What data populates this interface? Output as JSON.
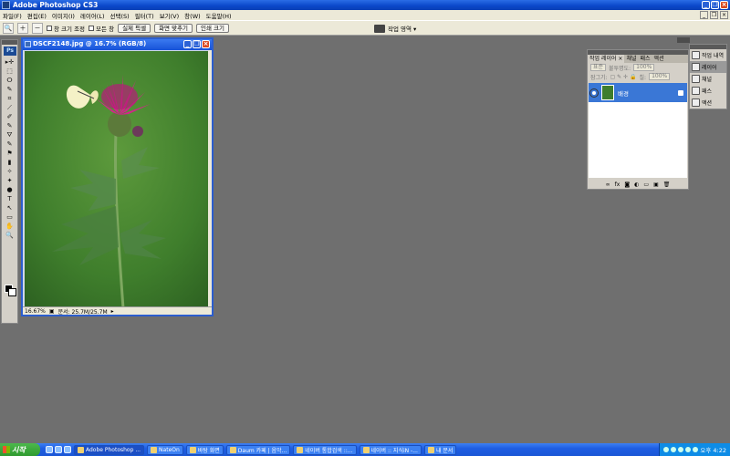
{
  "app": {
    "title": "Adobe Photoshop CS3",
    "icon": "photoshop-icon"
  },
  "menubar": {
    "items": [
      "파일(F)",
      "편집(E)",
      "이미지(I)",
      "레이어(L)",
      "선택(S)",
      "필터(T)",
      "보기(V)",
      "창(W)",
      "도움말(H)"
    ]
  },
  "options": {
    "resize_windows_label": "창 크기 조정",
    "all_windows_label": "모든 창",
    "actual_pixels_label": "실제 픽셀",
    "fit_screen_label": "화면 맞추기",
    "print_size_label": "인쇄 크기",
    "workspace_label": "작업 영역 ▾"
  },
  "toolbox": {
    "logo": "Ps",
    "tools": [
      "▸✛",
      "⬚",
      "ⵔ",
      "✎",
      "⌗",
      "⟋",
      "✐",
      "✎",
      "⛛",
      "✎",
      "⚑",
      "▮",
      "✧",
      "✦",
      "●",
      "T",
      "↖",
      "▭",
      "✋",
      "🔍"
    ]
  },
  "document": {
    "title": "DSCF2148.jpg @ 16.7% (RGB/8)",
    "zoom": "16.67%",
    "status": "문서: 25.7M/25.7M",
    "arrow": "▸"
  },
  "layers_panel": {
    "tabs": [
      "작업 레이어 ×",
      "채널",
      "패스",
      "액션"
    ],
    "blend_mode": "표준",
    "opacity_label": "불투명도:",
    "opacity_value": "100%",
    "lock_label": "잠그기:",
    "fill_label": "칠:",
    "fill_value": "100%",
    "layer_name": "배경"
  },
  "mini_dock": {
    "items": [
      "작업 내역",
      "레이어",
      "채널",
      "패스",
      "액션"
    ],
    "active": "레이어"
  },
  "taskbar": {
    "start_label": "시작",
    "tasks": [
      "Adobe Photoshop ...",
      "NateOn",
      "바탕 화면",
      "Daum 카페 | 음악...",
      "네이버 통합검색 ::...",
      "네이버 :: 지식iN -...",
      "내 문서"
    ],
    "clock": "오후 4:22"
  }
}
